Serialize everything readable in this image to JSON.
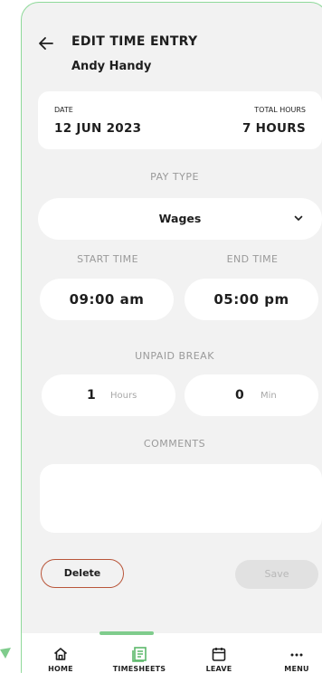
{
  "header": {
    "title": "EDIT TIME ENTRY",
    "employee_name": "Andy Handy",
    "back_icon": "arrow-left-icon"
  },
  "entry": {
    "date_label": "DATE",
    "date_value": "12 JUN 2023",
    "total_hours_label": "TOTAL HOURS",
    "total_hours_value": "7 HOURS"
  },
  "pay_type": {
    "label": "PAY TYPE",
    "selected": "Wages"
  },
  "times": {
    "start_label": "START TIME",
    "end_label": "END TIME",
    "start_value": "09:00 am",
    "end_value": "05:00 pm"
  },
  "unpaid_break": {
    "label": "UNPAID BREAK",
    "hours_value": "1",
    "hours_unit": "Hours",
    "min_value": "0",
    "min_unit": "Min"
  },
  "comments": {
    "label": "COMMENTS",
    "value": ""
  },
  "actions": {
    "delete_label": "Delete",
    "save_label": "Save"
  },
  "nav": {
    "active": "timesheets",
    "items": [
      {
        "label": "HOME",
        "icon": "home-icon"
      },
      {
        "label": "TIMESHEETS",
        "icon": "timesheets-icon"
      },
      {
        "label": "LEAVE",
        "icon": "calendar-icon"
      },
      {
        "label": "MENU",
        "icon": "more-icon"
      }
    ]
  },
  "colors": {
    "accent_green": "#7fcc8c",
    "screen_border": "#8fd99a",
    "delete_border": "#b9563a",
    "background": "#f2f2f2"
  }
}
